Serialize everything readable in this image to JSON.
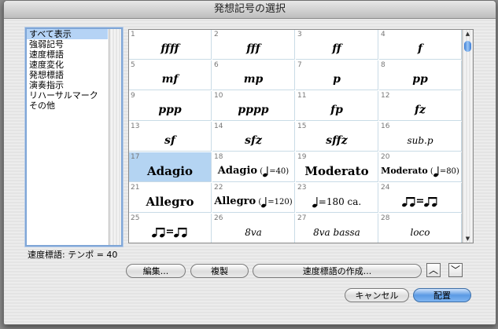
{
  "window": {
    "title": "発想記号の選択"
  },
  "list": {
    "items": [
      "すべて表示",
      "強弱記号",
      "速度標語",
      "速度変化",
      "発想標語",
      "演奏指示",
      "リハーサルマーク",
      "その他"
    ],
    "selected_index": 0
  },
  "status": "速度標語: テンポ = 40",
  "palette": {
    "cells": [
      {
        "num": "1",
        "label": "ffff"
      },
      {
        "num": "2",
        "label": "fff"
      },
      {
        "num": "3",
        "label": "ff"
      },
      {
        "num": "4",
        "label": "f"
      },
      {
        "num": "5",
        "label": "mf"
      },
      {
        "num": "6",
        "label": "mp"
      },
      {
        "num": "7",
        "label": "p"
      },
      {
        "num": "8",
        "label": "pp"
      },
      {
        "num": "9",
        "label": "ppp"
      },
      {
        "num": "10",
        "label": "pppp"
      },
      {
        "num": "11",
        "label": "fp"
      },
      {
        "num": "12",
        "label": "fz"
      },
      {
        "num": "13",
        "label": "sf"
      },
      {
        "num": "14",
        "label": "sfz"
      },
      {
        "num": "15",
        "label": "sffz"
      },
      {
        "num": "16",
        "label": "sub.p"
      },
      {
        "num": "17",
        "label": "Adagio"
      },
      {
        "num": "18",
        "label": "Adagio",
        "tempo": "=40)"
      },
      {
        "num": "19",
        "label": "Moderato"
      },
      {
        "num": "20",
        "label": "Moderato",
        "tempo": "=80)"
      },
      {
        "num": "21",
        "label": "Allegro"
      },
      {
        "num": "22",
        "label": "Allegro",
        "tempo": "=120)"
      },
      {
        "num": "23",
        "label": "=180 ca."
      },
      {
        "num": "24",
        "label": "="
      },
      {
        "num": "25",
        "label": "="
      },
      {
        "num": "26",
        "label": "8va"
      },
      {
        "num": "27",
        "label": "8va bassa"
      },
      {
        "num": "28",
        "label": "loco"
      }
    ],
    "selected_num": "17"
  },
  "buttons": {
    "edit": "編集...",
    "duplicate": "複製",
    "create": "速度標語の作成...",
    "cancel": "キャンセル",
    "place": "配置"
  }
}
